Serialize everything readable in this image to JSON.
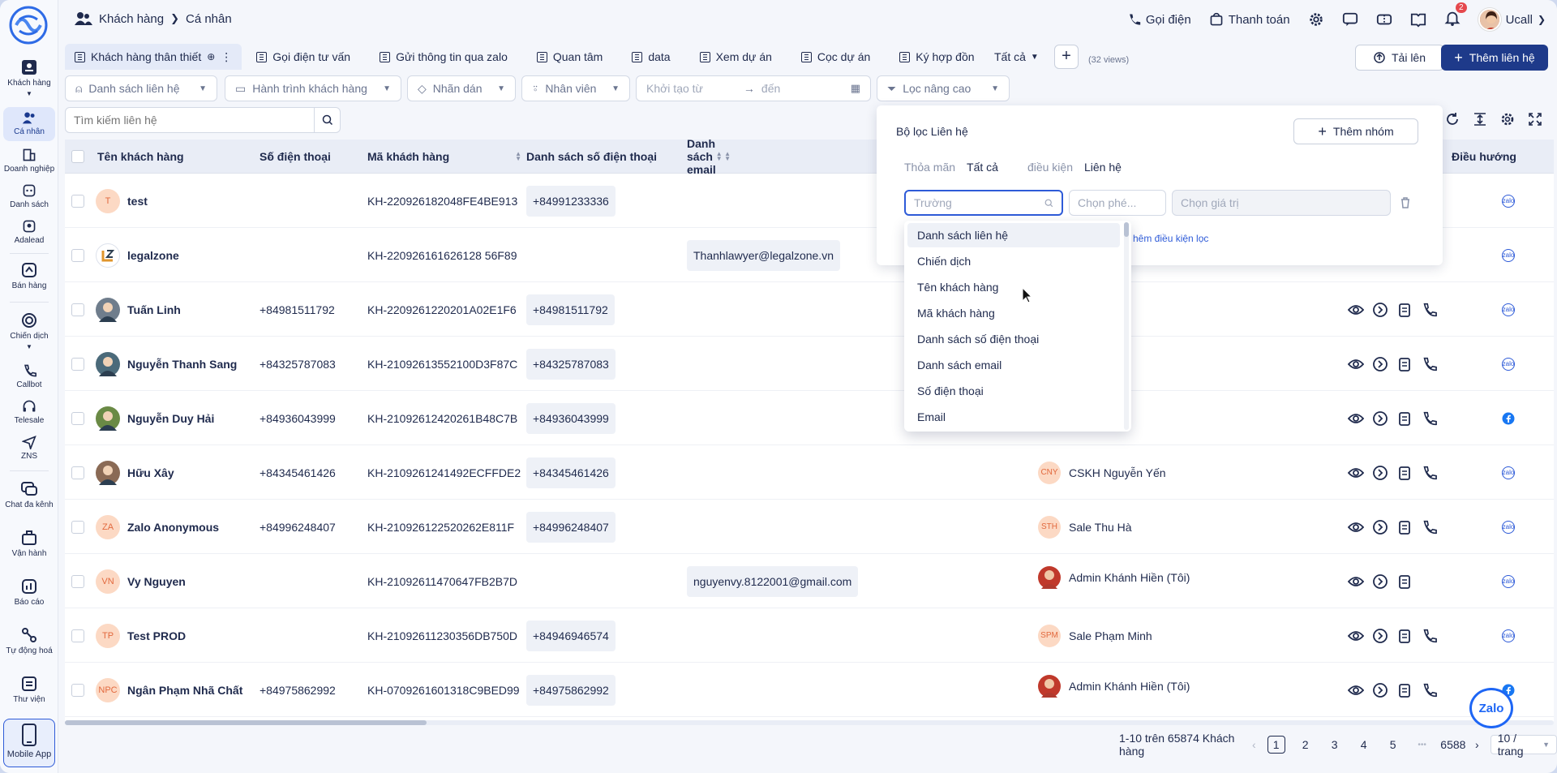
{
  "breadcrumb": {
    "root": "Khách hàng",
    "current": "Cá nhân"
  },
  "topbar": {
    "call": "Gọi điện",
    "payment": "Thanh toán",
    "notif_count": "2",
    "user": "Ucall"
  },
  "sidebar": [
    {
      "label": "Khách hàng",
      "icon": "contacts-icon"
    },
    {
      "label": "Cá nhân",
      "icon": "person-icon"
    },
    {
      "label": "Doanh nghiệp",
      "icon": "building-icon"
    },
    {
      "label": "Danh sách",
      "icon": "list-icon"
    },
    {
      "label": "Adalead",
      "icon": "target-icon"
    },
    {
      "label": "Bán hàng",
      "icon": "sales-icon"
    },
    {
      "label": "Chiến dịch",
      "icon": "campaign-icon"
    },
    {
      "label": "Callbot",
      "icon": "phone-icon"
    },
    {
      "label": "Telesale",
      "icon": "headset-icon"
    },
    {
      "label": "ZNS",
      "icon": "send-icon"
    },
    {
      "label": "Chat đa kênh",
      "icon": "chat-icon"
    },
    {
      "label": "Vận hành",
      "icon": "briefcase-icon"
    },
    {
      "label": "Báo cáo",
      "icon": "report-icon"
    },
    {
      "label": "Tự động hoá",
      "icon": "automation-icon"
    },
    {
      "label": "Thư viện",
      "icon": "library-icon"
    }
  ],
  "mobile_app": "Mobile App",
  "tabs": [
    "Khách hàng thân thiết",
    "Gọi điện tư vấn",
    "Gửi thông tin qua zalo",
    "Quan tâm",
    "data",
    "Xem dự án",
    "Cọc dự án",
    "Ký hợp đồn"
  ],
  "tabs_more": "Tất cả",
  "views_count": "(32 views)",
  "upload": "Tải lên",
  "add_contact": "Thêm liên hệ",
  "filters": {
    "list": "Danh sách liên hệ",
    "journey": "Hành trình khách hàng",
    "tag": "Nhãn dán",
    "staff": "Nhân viên",
    "created_from": "Khởi tạo từ",
    "to": "đến",
    "advanced": "Lọc nâng cao"
  },
  "search": {
    "placeholder": "Tìm kiếm liên hệ"
  },
  "columns": [
    "Tên khách hàng",
    "Số điện thoại",
    "Mã khách hàng",
    "Danh sách số điện thoại",
    "Danh sách email",
    "Điều hướng"
  ],
  "rows": [
    {
      "initials": "T",
      "name": "test",
      "phone": "",
      "code": "KH-220926182048FE4BE913",
      "phones": "+84991233336",
      "email": "",
      "staff_init": "",
      "staff": ""
    },
    {
      "initials": "",
      "name": "legalzone",
      "phone": "",
      "code": "KH-220926161626128 56F89",
      "phones": "",
      "email": "Thanhlawyer@legalzone.vn",
      "staff_init": "",
      "staff": ""
    },
    {
      "initials": "",
      "name": "Tuấn Linh",
      "phone": "+84981511792",
      "code": "KH-2209261220201A02E1F6",
      "phones": "+84981511792",
      "email": "",
      "staff_init": "",
      "staff": ""
    },
    {
      "initials": "",
      "name": "Nguyễn Thanh Sang",
      "phone": "+84325787083",
      "code": "KH-21092613552100D3F87C",
      "phones": "+84325787083",
      "email": "",
      "staff_init": "",
      "staff": "ễn Yến"
    },
    {
      "initials": "",
      "name": "Nguyễn Duy Hải",
      "phone": "+84936043999",
      "code": "KH-21092612420261B48C7B",
      "phones": "+84936043999",
      "email": "",
      "staff_init": "",
      "staff": ""
    },
    {
      "initials": "",
      "name": "Hữu Xây",
      "phone": "+84345461426",
      "code": "KH-2109261241492ECFFDE2",
      "phones": "+84345461426",
      "email": "",
      "staff_init": "CNY",
      "staff": "CSKH Nguyễn Yến"
    },
    {
      "initials": "ZA",
      "name": "Zalo Anonymous",
      "phone": "+84996248407",
      "code": "KH-210926122520262E811F",
      "phones": "+84996248407",
      "email": "",
      "staff_init": "STH",
      "staff": "Sale Thu Hà"
    },
    {
      "initials": "VN",
      "name": "Vy Nguyen",
      "phone": "",
      "code": "KH-21092611470647FB2B7D",
      "phones": "",
      "email": "nguyenvy.8122001@gmail.com",
      "staff_init": "",
      "staff": "Admin Khánh Hiền (Tôi)"
    },
    {
      "initials": "TP",
      "name": "Test PROD",
      "phone": "",
      "code": "KH-21092611230356DB750D",
      "phones": "+84946946574",
      "email": "",
      "staff_init": "SPM",
      "staff": "Sale Phạm Minh"
    },
    {
      "initials": "NPC",
      "name": "Ngân Phạm Nhã Chất",
      "phone": "+84975862992",
      "code": "KH-0709261601318C9BED99",
      "phones": "+84975862992",
      "email": "",
      "staff_init": "",
      "staff": "Admin Khánh Hiền (Tôi)"
    }
  ],
  "pagination": {
    "summary": "1-10 trên 65874 Khách hàng",
    "pages": [
      "1",
      "2",
      "3",
      "4",
      "5"
    ],
    "dots": "•••",
    "last": "6588",
    "per_page": "10 / trang"
  },
  "filter_panel": {
    "title": "Bộ lọc Liên hệ",
    "add_group": "Thêm nhóm",
    "satisfy": "Thỏa mãn",
    "all": "Tất cả",
    "condition": "điều kiện",
    "contact": "Liên hệ",
    "field_placeholder": "Trường",
    "op_placeholder": "Chọn phé...",
    "value_placeholder": "Chọn giá trị",
    "add_condition": "hêm điều kiện lọc"
  },
  "dropdown": [
    "Danh sách liên hệ",
    "Chiến dịch",
    "Tên khách hàng",
    "Mã khách hàng",
    "Danh sách số điện thoại",
    "Danh sách email",
    "Số điện thoại",
    "Email"
  ],
  "zalo_fab": "Zalo",
  "colors": {
    "primary": "#1e3a8a",
    "accent": "#2e5bd8",
    "initials_bg": "#fcd9c4",
    "initials_fg": "#e2693e"
  }
}
